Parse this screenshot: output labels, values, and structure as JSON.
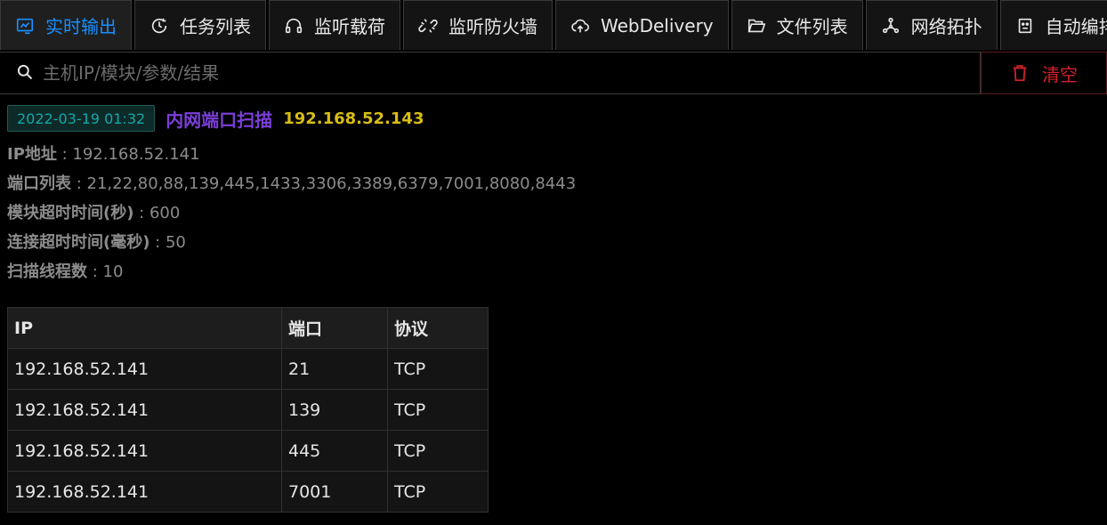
{
  "tabs": [
    {
      "label": "实时输出",
      "icon": "dashboard-icon",
      "active": true
    },
    {
      "label": "任务列表",
      "icon": "clock-icon",
      "active": false
    },
    {
      "label": "监听载荷",
      "icon": "headset-icon",
      "active": false
    },
    {
      "label": "监听防火墙",
      "icon": "disconnect-icon",
      "active": false
    },
    {
      "label": "WebDelivery",
      "icon": "cloud-upload-icon",
      "active": false
    },
    {
      "label": "文件列表",
      "icon": "folder-open-icon",
      "active": false
    },
    {
      "label": "网络拓扑",
      "icon": "topology-icon",
      "active": false
    },
    {
      "label": "自动编排",
      "icon": "robot-icon",
      "active": false
    }
  ],
  "search": {
    "placeholder": "主机IP/模块/参数/结果",
    "value": ""
  },
  "clear_button": {
    "label": "清空",
    "icon": "delete-icon",
    "color": "#d32029"
  },
  "log": {
    "timestamp": "2022-03-19 01:32",
    "module": "内网端口扫描",
    "target_ip": "192.168.52.143",
    "params": [
      {
        "key": "IP地址",
        "sep": " : ",
        "value": "192.168.52.141"
      },
      {
        "key": "端口列表",
        "sep": " : ",
        "value": "21,22,80,88,139,445,1433,3306,3389,6379,7001,8080,8443"
      },
      {
        "key": "模块超时时间(秒)",
        "sep": " : ",
        "value": "600"
      },
      {
        "key": "连接超时时间(毫秒)",
        "sep": " : ",
        "value": "50"
      },
      {
        "key": "扫描线程数",
        "sep": " : ",
        "value": "10"
      }
    ],
    "table": {
      "headers": [
        "IP",
        "端口",
        "协议"
      ],
      "rows": [
        [
          "192.168.52.141",
          "21",
          "TCP"
        ],
        [
          "192.168.52.141",
          "139",
          "TCP"
        ],
        [
          "192.168.52.141",
          "445",
          "TCP"
        ],
        [
          "192.168.52.141",
          "7001",
          "TCP"
        ]
      ]
    }
  },
  "colors": {
    "accent": "#1890ff",
    "module": "#7a3fd6",
    "target_ip": "#d8bd14",
    "timestamp": "#13a8a8",
    "danger": "#d32029"
  }
}
